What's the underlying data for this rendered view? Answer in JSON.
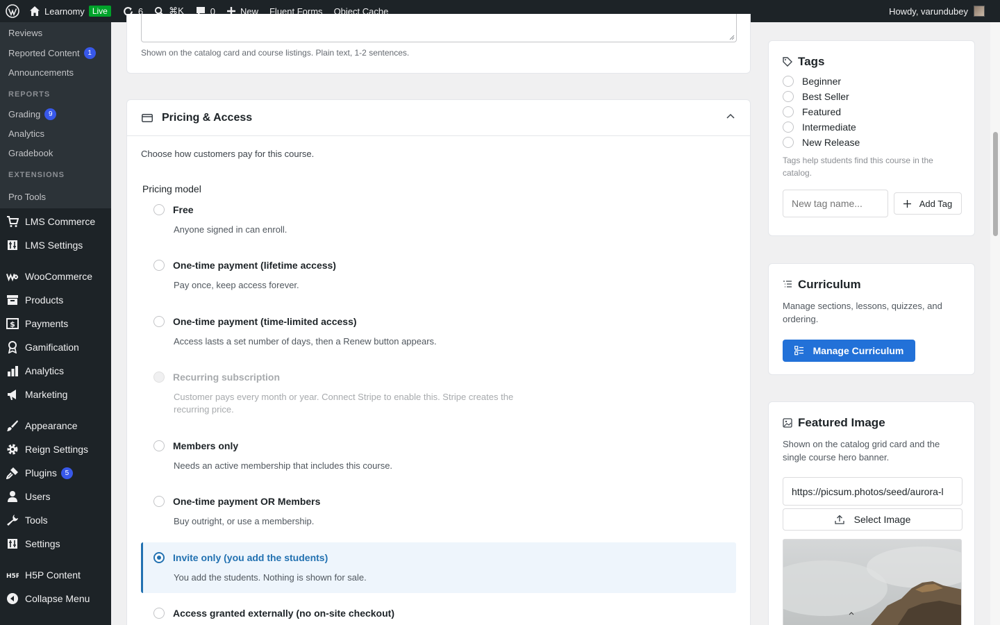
{
  "adminbar": {
    "site_name": "Learnomy",
    "live_badge": "Live",
    "updates_count": "6",
    "search_shortcut": "⌘K",
    "comments_count": "0",
    "new_label": "New",
    "fluent_forms": "Fluent Forms",
    "object_cache": "Object Cache",
    "howdy": "Howdy, varundubey"
  },
  "sidebar": {
    "submenu": [
      {
        "label": "Reviews"
      },
      {
        "label": "Reported Content",
        "badge": "1"
      },
      {
        "label": "Announcements"
      }
    ],
    "reports_heading": "REPORTS",
    "reports": [
      {
        "label": "Grading",
        "badge": "9"
      },
      {
        "label": "Analytics"
      },
      {
        "label": "Gradebook"
      }
    ],
    "extensions_heading": "EXTENSIONS",
    "extensions": [
      {
        "label": "Pro Tools"
      }
    ],
    "menu": [
      {
        "label": "LMS Commerce",
        "icon": "cart-icon"
      },
      {
        "label": "LMS Settings",
        "icon": "settings-grid-icon"
      },
      {
        "label": "WooCommerce",
        "icon": "woo-icon"
      },
      {
        "label": "Products",
        "icon": "archive-icon"
      },
      {
        "label": "Payments",
        "icon": "dollar-icon"
      },
      {
        "label": "Gamification",
        "icon": "award-icon"
      },
      {
        "label": "Analytics",
        "icon": "bar-chart-icon"
      },
      {
        "label": "Marketing",
        "icon": "megaphone-icon"
      },
      {
        "label": "Appearance",
        "icon": "brush-icon"
      },
      {
        "label": "Reign Settings",
        "icon": "gear-icon"
      },
      {
        "label": "Plugins",
        "icon": "plugin-icon",
        "badge": "5"
      },
      {
        "label": "Users",
        "icon": "user-icon"
      },
      {
        "label": "Tools",
        "icon": "wrench-icon"
      },
      {
        "label": "Settings",
        "icon": "sliders-icon"
      },
      {
        "label": "H5P Content",
        "icon": "h5p-icon"
      },
      {
        "label": "Collapse Menu",
        "icon": "collapse-icon"
      }
    ]
  },
  "excerpt": {
    "help": "Shown on the catalog card and course listings. Plain text, 1-2 sentences."
  },
  "pricing": {
    "title": "Pricing & Access",
    "intro": "Choose how customers pay for this course.",
    "model_label": "Pricing model",
    "options": [
      {
        "title": "Free",
        "desc": "Anyone signed in can enroll."
      },
      {
        "title": "One-time payment (lifetime access)",
        "desc": "Pay once, keep access forever."
      },
      {
        "title": "One-time payment (time-limited access)",
        "desc": "Access lasts a set number of days, then a Renew button appears."
      },
      {
        "title": "Recurring subscription",
        "desc": "Customer pays every month or year. Connect Stripe to enable this. Stripe creates the recurring price."
      },
      {
        "title": "Members only",
        "desc": "Needs an active membership that includes this course."
      },
      {
        "title": "One-time payment OR Members",
        "desc": "Buy outright, or use a membership."
      },
      {
        "title": "Invite only (you add the students)",
        "desc": "You add the students. Nothing is shown for sale."
      },
      {
        "title": "Access granted externally (no on-site checkout)",
        "desc": ""
      }
    ],
    "selected_index": 6,
    "disabled_index": 3
  },
  "tags": {
    "title": "Tags",
    "items": [
      "Beginner",
      "Best Seller",
      "Featured",
      "Intermediate",
      "New Release"
    ],
    "help": "Tags help students find this course in the catalog.",
    "input_placeholder": "New tag name...",
    "add_button": "Add Tag"
  },
  "curriculum": {
    "title": "Curriculum",
    "desc": "Manage sections, lessons, quizzes, and ordering.",
    "button": "Manage Curriculum"
  },
  "featured_image": {
    "title": "Featured Image",
    "desc": "Shown on the catalog grid card and the single course hero banner.",
    "url_value": "https://picsum.photos/seed/aurora-l",
    "select_button": "Select Image"
  },
  "colors": {
    "accent": "#2271b1",
    "primary_button": "#2271d8",
    "badge": "#3858e9",
    "sidebar": "#1d2327"
  }
}
